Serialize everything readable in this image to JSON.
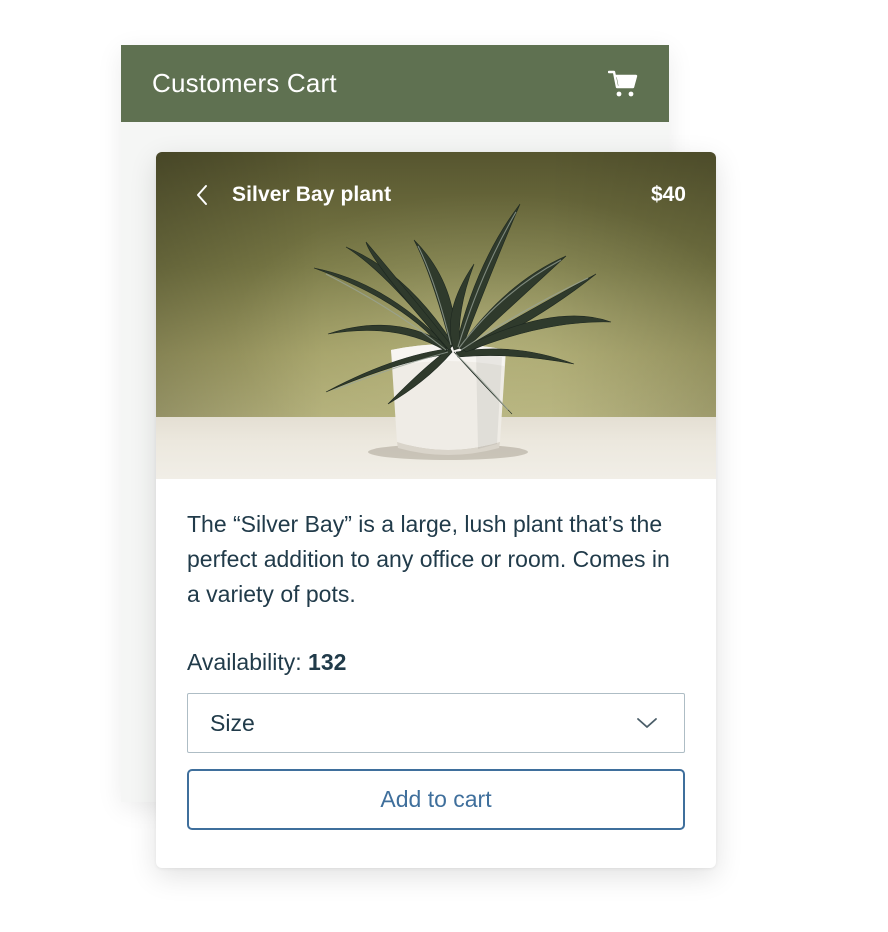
{
  "cart": {
    "title": "Customers Cart",
    "icon": "shopping-cart-icon"
  },
  "product": {
    "name": "Silver Bay plant",
    "price": "$40",
    "back_icon": "chevron-left-icon",
    "image": "potted-plant-photo",
    "description": "The “Silver Bay” is a large, lush plant that’s the perfect addition to any office or room. Comes in a variety of pots.",
    "availability_label": "Availability:",
    "availability_count": "132"
  },
  "size_select": {
    "selected": "Size",
    "icon": "chevron-down-icon"
  },
  "actions": {
    "add_to_cart_label": "Add to cart"
  },
  "colors": {
    "header_green": "#5f7151",
    "text_dark": "#213b4a",
    "button_blue": "#3f6f9c"
  }
}
